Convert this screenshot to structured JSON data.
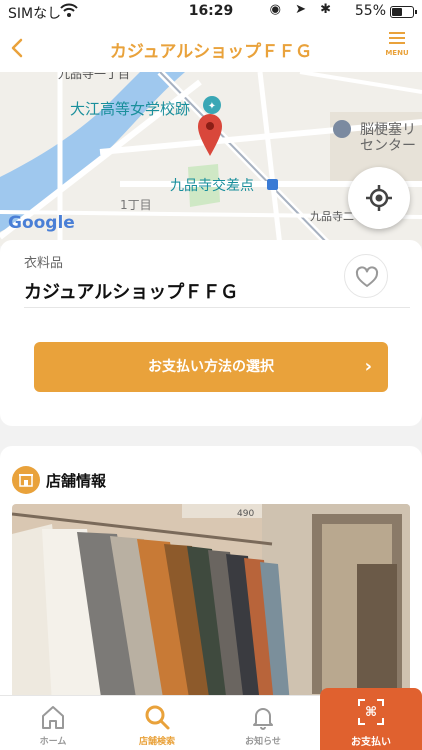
{
  "status": {
    "carrier": "SIMなし",
    "time": "16:29",
    "battery": "55%",
    "battery_level": 0.55
  },
  "navbar": {
    "title": "カジュアルショップＦＦＧ",
    "menu_label": "MENU"
  },
  "map": {
    "labels": {
      "block": "九品寺一丁目",
      "school": "大江高等女学校跡",
      "center_line1": "脳梗塞リ",
      "center_line2": "センター",
      "intersection": "九品寺交差点",
      "chome": "1丁目",
      "block2": "九品寺二"
    },
    "logo": "Google"
  },
  "shop": {
    "category": "衣料品",
    "name": "カジュアルショップＦＦＧ",
    "pay_method_label": "お支払い方法の選択"
  },
  "store_info": {
    "title": "店舗情報",
    "photo_sign": "490"
  },
  "tabbar": {
    "home": "ホーム",
    "search": "店舗検索",
    "notice": "お知らせ",
    "pay": "お支払い"
  },
  "colors": {
    "accent": "#e9a23b",
    "pay_button": "#e0612f",
    "pin": "#d9473b"
  }
}
